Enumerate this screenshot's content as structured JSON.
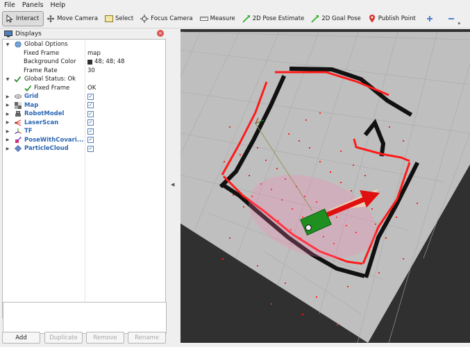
{
  "menu": [
    "File",
    "Panels",
    "Help"
  ],
  "toolbar": {
    "tools": [
      {
        "label": "Interact",
        "icon": "cursor-icon",
        "active": true
      },
      {
        "label": "Move Camera",
        "icon": "move-camera-icon"
      },
      {
        "label": "Select",
        "icon": "select-box-icon"
      },
      {
        "label": "Focus Camera",
        "icon": "focus-camera-icon"
      },
      {
        "label": "Measure",
        "icon": "ruler-icon"
      },
      {
        "label": "2D Pose Estimate",
        "icon": "pose-arrow-icon"
      },
      {
        "label": "2D Goal Pose",
        "icon": "goal-arrow-icon"
      },
      {
        "label": "Publish Point",
        "icon": "map-pin-icon"
      }
    ],
    "plus_icon": "plus-icon",
    "minus_icon": "minus-icon"
  },
  "displays": {
    "title": "Displays",
    "rows": [
      {
        "label": "Global Options",
        "icon": "globe-icon",
        "expanded": true,
        "depth": 0
      },
      {
        "label": "Fixed Frame",
        "value": "map",
        "depth": 1
      },
      {
        "label": "Background Color",
        "value": "48; 48; 48",
        "swatch": "#303030",
        "depth": 1
      },
      {
        "label": "Frame Rate",
        "value": "30",
        "depth": 1
      },
      {
        "label": "Global Status: Ok",
        "icon": "check-icon",
        "expanded": true,
        "depth": 0
      },
      {
        "label": "Fixed Frame",
        "value": "OK",
        "icon": "check-icon",
        "depth": 1
      },
      {
        "label": "Grid",
        "icon": "grid-icon",
        "checked": true,
        "depth": 0
      },
      {
        "label": "Map",
        "icon": "map-icon",
        "checked": true,
        "depth": 0
      },
      {
        "label": "RobotModel",
        "icon": "robot-icon",
        "checked": true,
        "depth": 0
      },
      {
        "label": "LaserScan",
        "icon": "laser-icon",
        "checked": true,
        "depth": 0
      },
      {
        "label": "TF",
        "icon": "tf-axes-icon",
        "checked": true,
        "depth": 0
      },
      {
        "label": "PoseWithCovari...",
        "icon": "pose-covariance-icon",
        "checked": true,
        "depth": 0
      },
      {
        "label": "ParticleCloud",
        "icon": "particle-cloud-icon",
        "checked": true,
        "depth": 0
      }
    ],
    "buttons": {
      "add": "Add",
      "duplicate": "Duplicate",
      "remove": "Remove",
      "rename": "Rename"
    }
  },
  "colors": {
    "background": "#303030",
    "grid_plane": "#bdbdbd",
    "laser": "#ff1a1a",
    "robot": "#1f8f1f",
    "accent_label": "#2b66b3"
  }
}
